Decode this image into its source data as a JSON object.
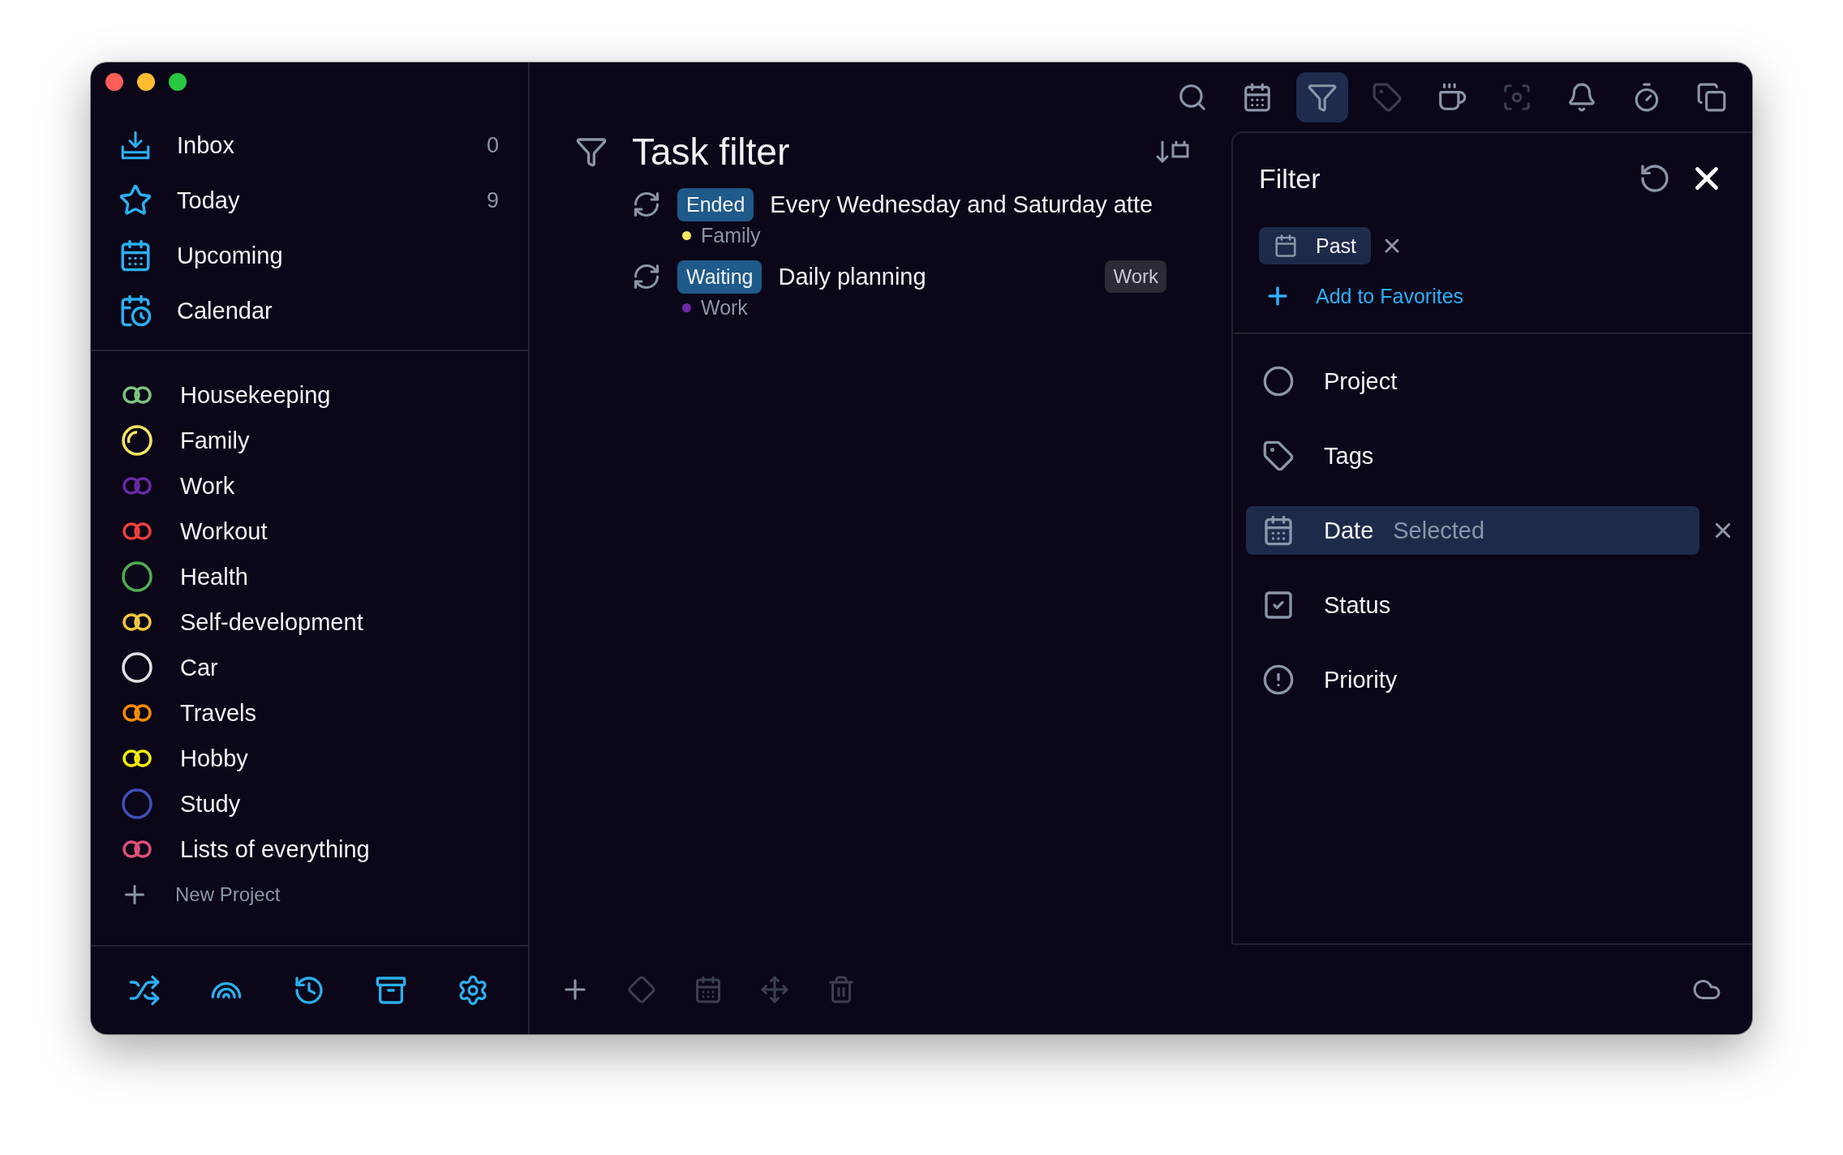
{
  "sidebar": {
    "nav": [
      {
        "kind": "inbox",
        "label": "Inbox",
        "count": "0"
      },
      {
        "kind": "today",
        "label": "Today",
        "count": "9"
      },
      {
        "kind": "upcoming",
        "label": "Upcoming"
      },
      {
        "kind": "calendar",
        "label": "Calendar"
      }
    ],
    "projects": [
      {
        "kind": "double",
        "label": "Housekeeping",
        "color": "#7cc47f"
      },
      {
        "kind": "partial",
        "label": "Family",
        "color": "#f5e663"
      },
      {
        "kind": "double",
        "label": "Work",
        "color": "#6a2aa8"
      },
      {
        "kind": "double",
        "label": "Workout",
        "color": "#f0403a"
      },
      {
        "kind": "ring",
        "label": "Health",
        "color": "#4caf50"
      },
      {
        "kind": "double",
        "label": "Self-development",
        "color": "#f5c842"
      },
      {
        "kind": "ring",
        "label": "Car",
        "color": "#e0e0e0"
      },
      {
        "kind": "double",
        "label": "Travels",
        "color": "#ff8c00"
      },
      {
        "kind": "double",
        "label": "Hobby",
        "color": "#f5f000"
      },
      {
        "kind": "ring",
        "label": "Study",
        "color": "#3f4fb8"
      },
      {
        "kind": "double",
        "label": "Lists of everything",
        "color": "#e0507a"
      }
    ],
    "new_project": "New Project",
    "actions": [
      {
        "kind": "shuffle"
      },
      {
        "kind": "rainbow"
      },
      {
        "kind": "history"
      },
      {
        "kind": "trash"
      },
      {
        "kind": "settings"
      }
    ]
  },
  "toolbar": [
    {
      "kind": "search",
      "selected": false,
      "disabled": false
    },
    {
      "kind": "calendar",
      "selected": false,
      "disabled": false
    },
    {
      "kind": "filter",
      "selected": true,
      "disabled": false
    },
    {
      "kind": "tag",
      "selected": false,
      "disabled": true
    },
    {
      "kind": "coffee",
      "selected": false,
      "disabled": false
    },
    {
      "kind": "focus",
      "selected": false,
      "disabled": true
    },
    {
      "kind": "bell",
      "selected": false,
      "disabled": false
    },
    {
      "kind": "timer",
      "selected": false,
      "disabled": false
    },
    {
      "kind": "copy",
      "selected": false,
      "disabled": false
    }
  ],
  "main": {
    "title": "Task filter",
    "tasks": [
      {
        "status": "Ended",
        "title": "Every Wednesday and Saturday atte",
        "project": "Family",
        "color": "#f5e663"
      },
      {
        "status": "Waiting",
        "title": "Daily planning",
        "tag": "Work",
        "project": "Work",
        "color": "#6a2aa8"
      }
    ],
    "actions": [
      {
        "kind": "add",
        "disabled": false
      },
      {
        "kind": "move-to",
        "disabled": true
      },
      {
        "kind": "schedule",
        "disabled": true
      },
      {
        "kind": "move",
        "disabled": true
      },
      {
        "kind": "trash",
        "disabled": true
      }
    ]
  },
  "filter": {
    "title": "Filter",
    "chips": [
      {
        "label": "Past"
      }
    ],
    "add_favorites": "Add to Favorites",
    "criteria": [
      {
        "kind": "project",
        "label": "Project",
        "selected": false
      },
      {
        "kind": "tags",
        "label": "Tags",
        "selected": false
      },
      {
        "kind": "date",
        "label": "Date",
        "value": "Selected",
        "selected": true
      },
      {
        "kind": "status",
        "label": "Status",
        "selected": false
      },
      {
        "kind": "priority",
        "label": "Priority",
        "selected": false
      }
    ]
  }
}
